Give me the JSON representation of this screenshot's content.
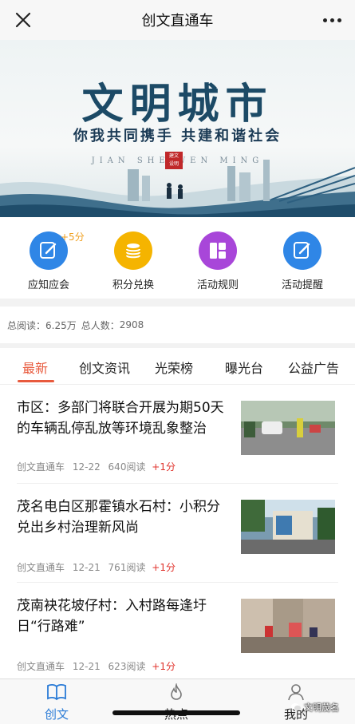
{
  "header": {
    "title": "创文直通车",
    "close_icon": "close-icon",
    "more_icon": "more-icon"
  },
  "banner": {
    "headline": "文明城市",
    "subline": "你我共同携手 共建和谐社会",
    "pinyin": "JIAN SHE        WEN MING",
    "seal_text": "建文设明"
  },
  "actions": [
    {
      "label": "应知应会",
      "icon": "edit-icon",
      "bonus": "+5分",
      "color": "#2f86e6"
    },
    {
      "label": "积分兑换",
      "icon": "coins-icon",
      "color": "#f5b400"
    },
    {
      "label": "活动规则",
      "icon": "grid-icon",
      "color": "#a846d9"
    },
    {
      "label": "活动提醒",
      "icon": "edit-icon",
      "color": "#2f86e6"
    }
  ],
  "stats": {
    "reads_label": "总阅读：",
    "reads_value": "6.25万",
    "people_label": "总人数：",
    "people_value": "2908"
  },
  "tabs": [
    "最新",
    "创文资讯",
    "光荣榜",
    "曝光台",
    "公益广告"
  ],
  "articles": [
    {
      "title": "市区：多部门将联合开展为期50天的车辆乱停乱放等环境乱象整治",
      "source": "创文直通车",
      "date": "12-22",
      "reads": "640阅读",
      "points": "+1分"
    },
    {
      "title": "茂名电白区那霍镇水石村：小积分兑出乡村治理新风尚",
      "source": "创文直通车",
      "date": "12-21",
      "reads": "761阅读",
      "points": "+1分"
    },
    {
      "title": "茂南袂花坡仔村：入村路每逢圩日“行路难”",
      "source": "创文直通车",
      "date": "12-21",
      "reads": "623阅读",
      "points": "+1分"
    }
  ],
  "bottom_nav": [
    {
      "label": "创文",
      "icon": "book-icon"
    },
    {
      "label": "热点",
      "icon": "flame-icon"
    },
    {
      "label": "我的",
      "icon": "user-icon"
    }
  ],
  "watermark": "文明茂名",
  "colors": {
    "accent": "#e85a3d",
    "nav_active": "#2a7bd6",
    "points": "#e0322b"
  }
}
